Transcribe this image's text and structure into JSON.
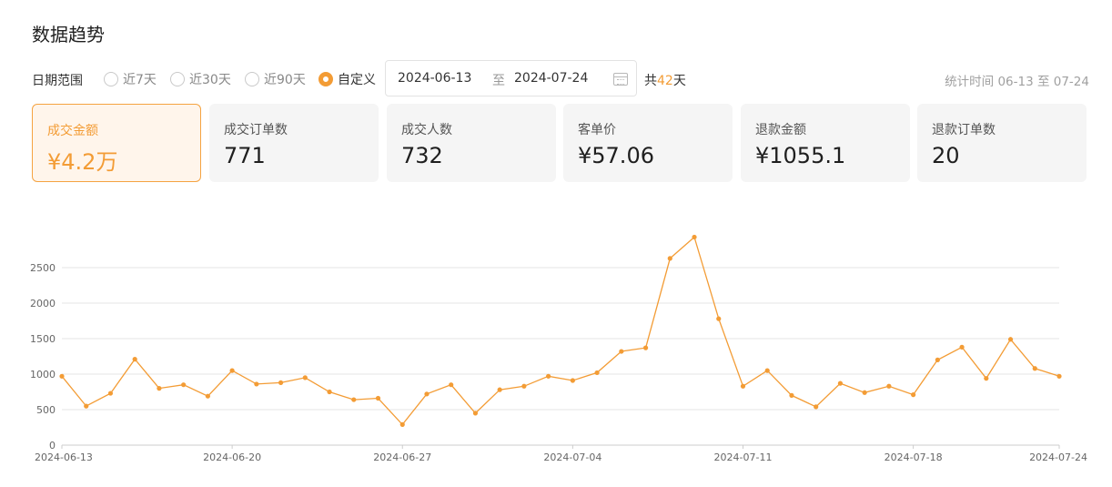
{
  "page_title": "数据趋势",
  "filter": {
    "label": "日期范围",
    "options": [
      {
        "label": "近7天",
        "selected": false
      },
      {
        "label": "近30天",
        "selected": false
      },
      {
        "label": "近90天",
        "selected": false
      },
      {
        "label": "自定义",
        "selected": true
      }
    ],
    "start_date": "2024-06-13",
    "separator": "至",
    "end_date": "2024-07-24",
    "days_prefix": "共",
    "days_count": "42",
    "days_suffix": "天",
    "stat_time": "统计时间 06-13 至 07-24"
  },
  "metrics": [
    {
      "label": "成交金额",
      "value": "¥4.2万",
      "active": true
    },
    {
      "label": "成交订单数",
      "value": "771",
      "active": false
    },
    {
      "label": "成交人数",
      "value": "732",
      "active": false
    },
    {
      "label": "客单价",
      "value": "¥57.06",
      "active": false
    },
    {
      "label": "退款金额",
      "value": "¥1055.1",
      "active": false
    },
    {
      "label": "退款订单数",
      "value": "20",
      "active": false
    }
  ],
  "colors": {
    "accent": "#f39c35",
    "grid": "#e4e4e4",
    "axis": "#cccccc"
  },
  "chart_data": {
    "type": "line",
    "title": "",
    "xlabel": "",
    "ylabel": "",
    "ylim": [
      0,
      2800
    ],
    "yticks": [
      0,
      500,
      1000,
      1500,
      2000,
      2500
    ],
    "xtick_labels": [
      "2024-06-13",
      "2024-06-20",
      "2024-06-27",
      "2024-07-04",
      "2024-07-11",
      "2024-07-18",
      "2024-07-24"
    ],
    "x": [
      "2024-06-13",
      "2024-06-14",
      "2024-06-15",
      "2024-06-16",
      "2024-06-17",
      "2024-06-18",
      "2024-06-19",
      "2024-06-20",
      "2024-06-21",
      "2024-06-22",
      "2024-06-23",
      "2024-06-24",
      "2024-06-25",
      "2024-06-26",
      "2024-06-27",
      "2024-06-28",
      "2024-06-29",
      "2024-06-30",
      "2024-07-01",
      "2024-07-02",
      "2024-07-03",
      "2024-07-04",
      "2024-07-05",
      "2024-07-06",
      "2024-07-07",
      "2024-07-08",
      "2024-07-09",
      "2024-07-10",
      "2024-07-11",
      "2024-07-12",
      "2024-07-13",
      "2024-07-14",
      "2024-07-15",
      "2024-07-16",
      "2024-07-17",
      "2024-07-18",
      "2024-07-19",
      "2024-07-20",
      "2024-07-21",
      "2024-07-22",
      "2024-07-23",
      "2024-07-24"
    ],
    "series": [
      {
        "values": [
          970,
          550,
          730,
          1210,
          800,
          850,
          690,
          1050,
          860,
          880,
          950,
          750,
          640,
          660,
          290,
          720,
          850,
          450,
          780,
          830,
          970,
          910,
          1020,
          1320,
          1370,
          2630,
          2930,
          1780,
          830,
          1050,
          700,
          540,
          870,
          740,
          830,
          710,
          1200,
          1380,
          940,
          1490,
          1080,
          970
        ]
      }
    ],
    "grid": true,
    "legend": "none",
    "marker": "circle"
  }
}
